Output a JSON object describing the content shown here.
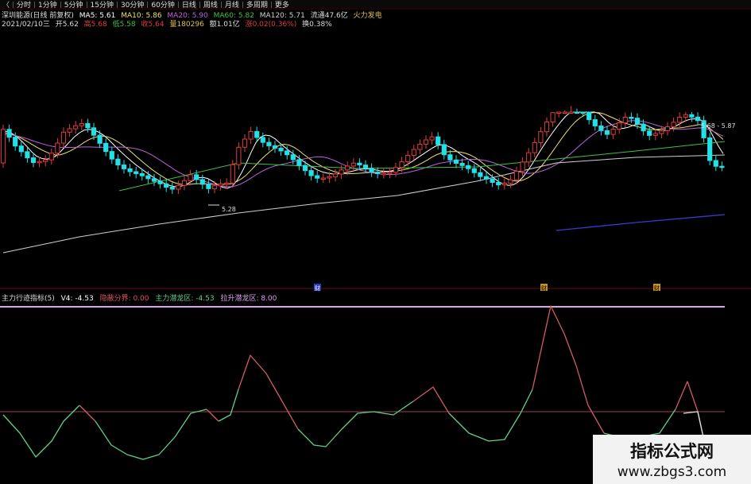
{
  "toolbar": {
    "items": [
      "〈",
      "分时",
      "1分钟",
      "5分钟",
      "15分钟",
      "30分钟",
      "60分钟",
      "日线",
      "周线",
      "月线",
      "多周期",
      "更多"
    ]
  },
  "info1": {
    "name": "深圳能源(日线 前复权)",
    "ma5": "MA5: 5.61",
    "ma10": "MA10: 5.86",
    "ma20": "MA20: 5.90",
    "ma60": "MA60: 5.82",
    "ma120": "MA120: 5.71",
    "liutong": "流通47.6亿",
    "concept": "火力发电"
  },
  "info2": {
    "date": "2021/02/10三",
    "open": "开5.62",
    "high": "高5.68",
    "low": "低5.58",
    "close": "收5.64",
    "vol": "量180296",
    "amount": "额1.01亿",
    "change": "涨0.02(0.36%)",
    "turnover": "换0.38%"
  },
  "indicator": {
    "name": "主力行迹指标(5)",
    "v4": "V4: -4.53",
    "zone1": "隐蔽分界: 0.00",
    "zone2": "主力潜龙区: -4.53",
    "zone3": "拉升潜龙区: 8.00"
  },
  "markers": [
    "财",
    "财",
    "财"
  ],
  "chart_labels": {
    "low_label": "5.28",
    "price_box": "5.68 - 5.87"
  },
  "watermark": {
    "line1": "指标公式网",
    "line2": "www.zbgs3.com"
  },
  "colors": {
    "up": "#e03c3c",
    "down": "#22e0e6",
    "ma5": "#ffffff",
    "ma10": "#f0e070",
    "ma20": "#c060e0",
    "ma60": "#40c040",
    "ma120": "#d0d0d0",
    "ma250": "#3a3ad0",
    "ind_red": "#d05a6a",
    "ind_green": "#5fd08a",
    "ind_white": "#e0e0e0"
  },
  "chart_data": [
    {
      "type": "candlestick",
      "title": "深圳能源(日线 前复权)",
      "series": [
        {
          "name": "MA5"
        },
        {
          "name": "MA10"
        },
        {
          "name": "MA20"
        },
        {
          "name": "MA60"
        },
        {
          "name": "MA120"
        }
      ]
    },
    {
      "type": "line",
      "title": "主力行迹指标(5)",
      "series": [
        {
          "name": "V4",
          "last": -4.53
        }
      ],
      "levels": [
        0.0,
        8.0
      ]
    }
  ]
}
